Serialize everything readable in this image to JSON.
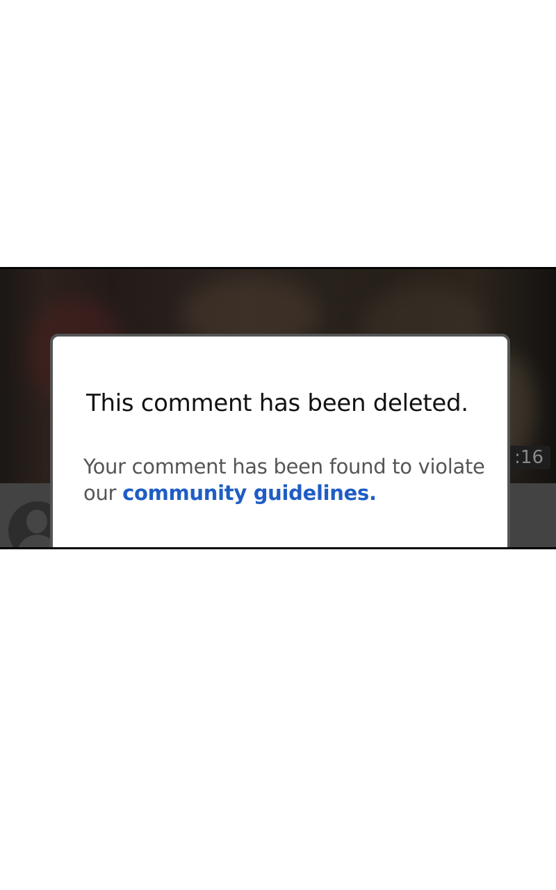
{
  "video": {
    "timestamp": ":16"
  },
  "dialog": {
    "title": "This comment has been deleted.",
    "message_prefix": "Your comment has been found to violate our ",
    "link_text": "community guidelines.",
    "link_color": "#1f5dc4"
  },
  "avatar": {
    "icon": "person-icon"
  }
}
